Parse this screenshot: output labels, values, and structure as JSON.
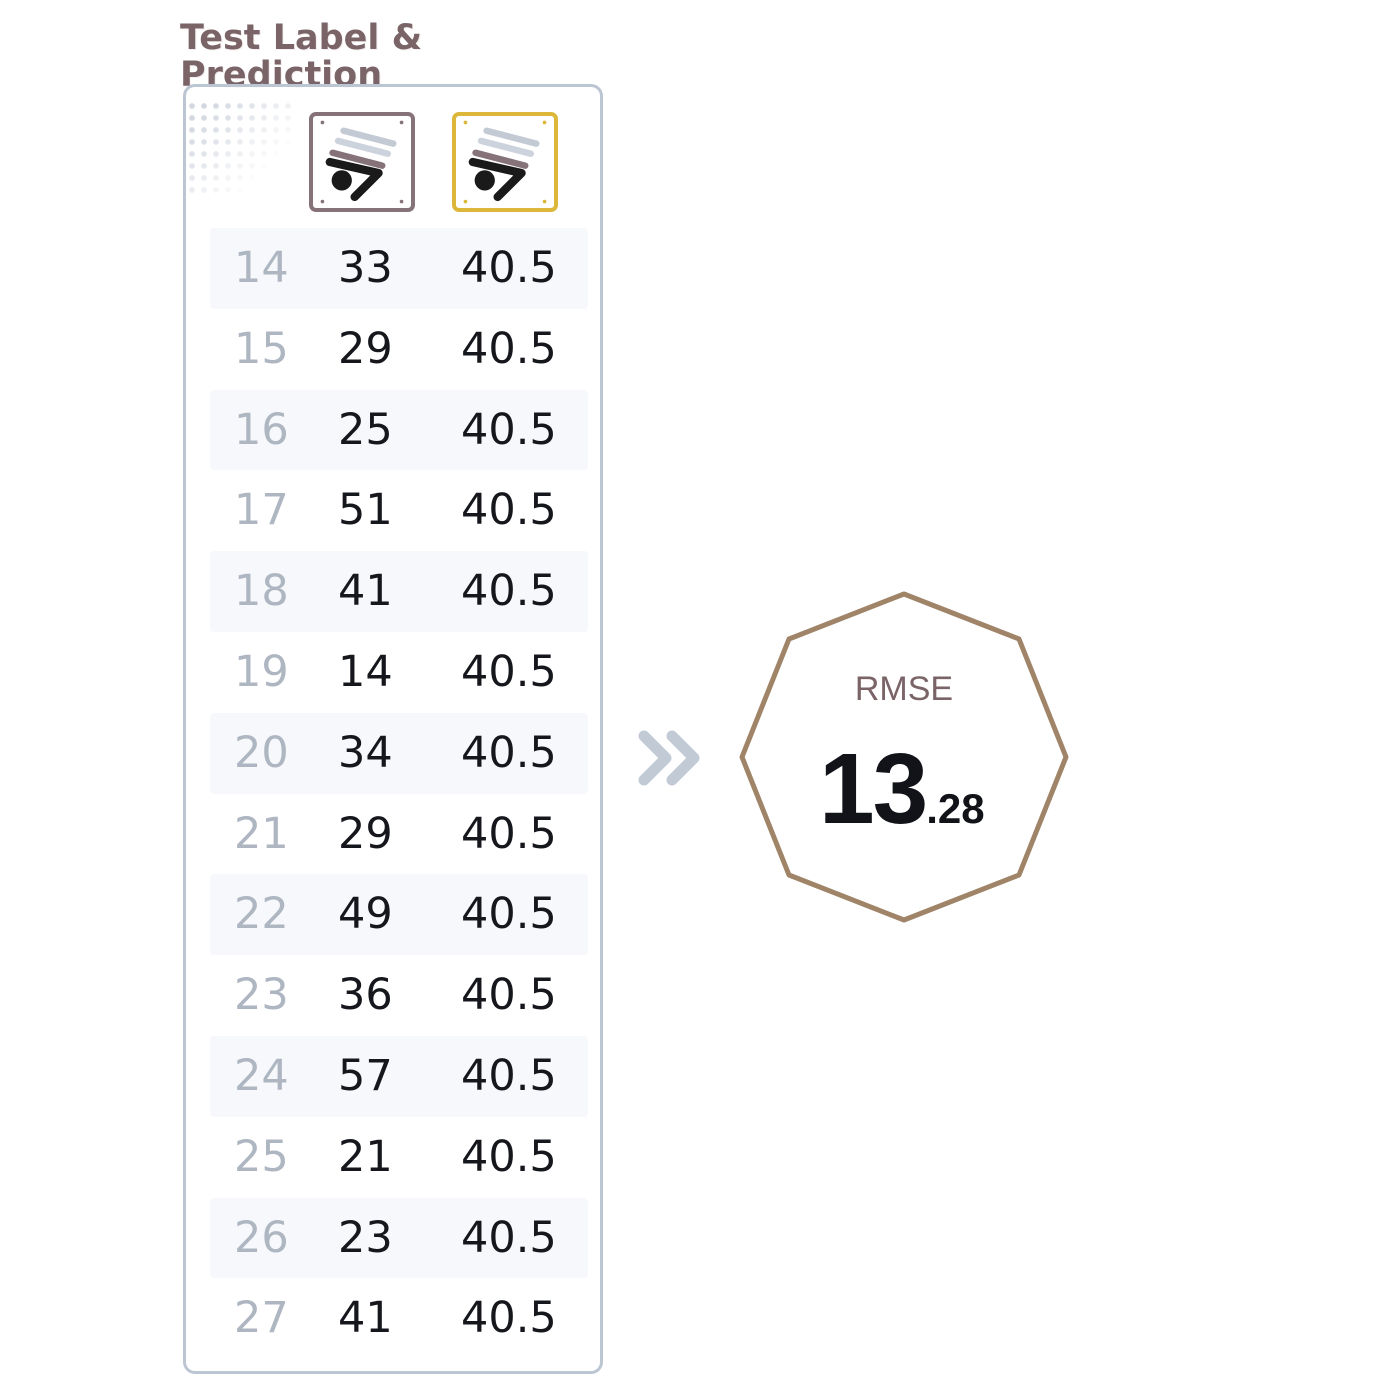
{
  "title": {
    "line1": "Test Label &",
    "line2": "Prediction"
  },
  "columns": {
    "label_icon": "figure-seven-icon",
    "prediction_icon": "figure-seven-icon"
  },
  "colors": {
    "label_border": "#86737a",
    "prediction_border": "#dcb73a",
    "badge_outline": "#a08468",
    "panel_border": "#bcc5d2"
  },
  "rows": [
    {
      "index": "14",
      "label": "33",
      "prediction": "40.5"
    },
    {
      "index": "15",
      "label": "29",
      "prediction": "40.5"
    },
    {
      "index": "16",
      "label": "25",
      "prediction": "40.5"
    },
    {
      "index": "17",
      "label": "51",
      "prediction": "40.5"
    },
    {
      "index": "18",
      "label": "41",
      "prediction": "40.5"
    },
    {
      "index": "19",
      "label": "14",
      "prediction": "40.5"
    },
    {
      "index": "20",
      "label": "34",
      "prediction": "40.5"
    },
    {
      "index": "21",
      "label": "29",
      "prediction": "40.5"
    },
    {
      "index": "22",
      "label": "49",
      "prediction": "40.5"
    },
    {
      "index": "23",
      "label": "36",
      "prediction": "40.5"
    },
    {
      "index": "24",
      "label": "57",
      "prediction": "40.5"
    },
    {
      "index": "25",
      "label": "21",
      "prediction": "40.5"
    },
    {
      "index": "26",
      "label": "23",
      "prediction": "40.5"
    },
    {
      "index": "27",
      "label": "41",
      "prediction": "40.5"
    }
  ],
  "arrow_icon": "double-chevron-right-icon",
  "metric": {
    "name": "RMSE",
    "value_int": "13",
    "value_dec": ".28"
  }
}
